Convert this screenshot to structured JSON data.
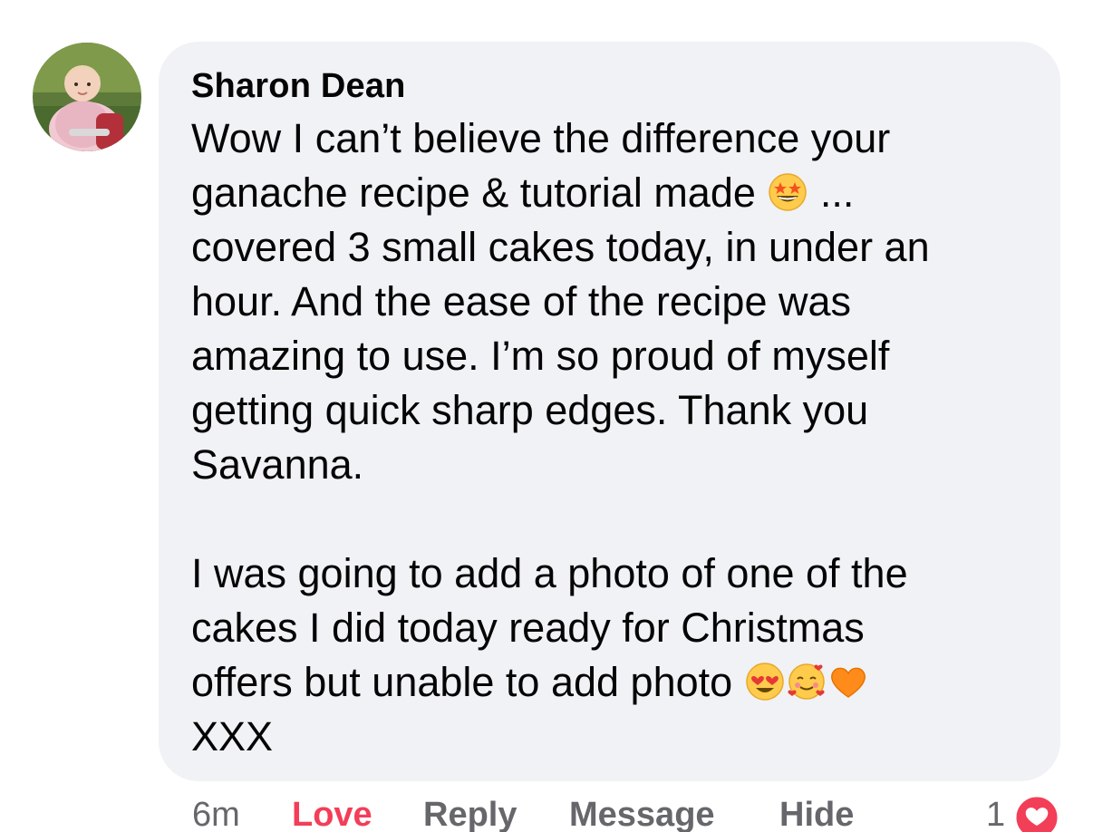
{
  "comment": {
    "author": "Sharon Dean",
    "avatar_icon": "avatar-photo-child",
    "lines": {
      "l1": "Wow I can’t believe the difference your",
      "l2a": "ganache recipe & tutorial made",
      "l2b": "...",
      "l3": "covered 3 small cakes today, in under an",
      "l4": "hour. And the ease of the recipe was",
      "l5": "amazing to use. I’m so proud of myself",
      "l6": "getting quick sharp edges. Thank you",
      "l7": "Savanna.",
      "l8": "I was going to add a photo of one of the",
      "l9": "cakes I did today ready for Christmas",
      "l10": "offers but unable to add photo",
      "l11": "XXX"
    },
    "emojis": [
      "star-struck-emoji",
      "heart-eyes-emoji",
      "smiling-face-with-hearts-emoji",
      "orange-heart-emoji"
    ]
  },
  "actions": {
    "time": "6m",
    "love": "Love",
    "reply": "Reply",
    "message": "Message",
    "hide": "Hide",
    "reaction_count": "1",
    "reaction_icon": "love-reaction-icon"
  },
  "colors": {
    "bubble": "#f0f2f5",
    "love": "#f33e58",
    "secondary_text": "#65676b"
  }
}
